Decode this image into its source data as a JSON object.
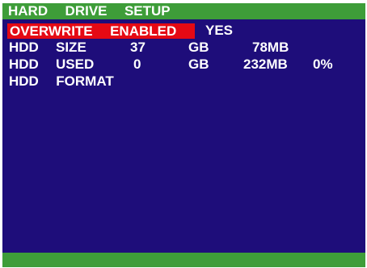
{
  "title": "HARD  DRIVE  SETUP",
  "colors": {
    "background": "#1e0d7a",
    "title_bar": "#3e9d39",
    "highlight": "#e50914",
    "text": "#ffffff"
  },
  "menu": {
    "overwrite": {
      "label": "OVERWRITE  ENABLED",
      "value": "YES"
    },
    "hdd_size": {
      "label_a": "HDD",
      "label_b": "SIZE",
      "gb_value": "37",
      "gb_unit": "GB",
      "mb_value": "78MB"
    },
    "hdd_used": {
      "label_a": "HDD",
      "label_b": "USED",
      "gb_value": "0",
      "gb_unit": "GB",
      "mb_value": "232MB",
      "percent": "0%"
    },
    "hdd_format": {
      "label": "HDD  FORMAT"
    }
  }
}
